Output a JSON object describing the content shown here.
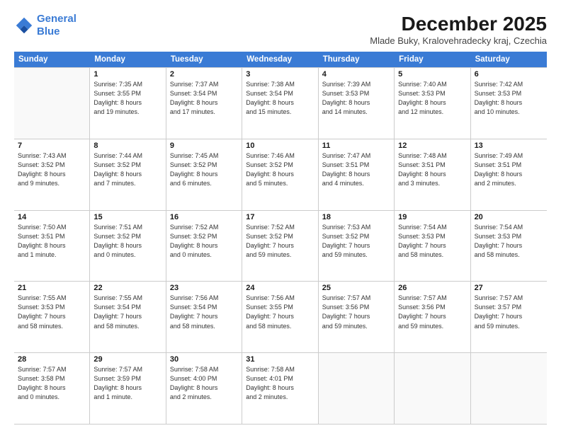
{
  "logo": {
    "line1": "General",
    "line2": "Blue"
  },
  "title": "December 2025",
  "subtitle": "Mlade Buky, Kralovehradecky kraj, Czechia",
  "header_days": [
    "Sunday",
    "Monday",
    "Tuesday",
    "Wednesday",
    "Thursday",
    "Friday",
    "Saturday"
  ],
  "weeks": [
    [
      {
        "day": "",
        "info": ""
      },
      {
        "day": "1",
        "info": "Sunrise: 7:35 AM\nSunset: 3:55 PM\nDaylight: 8 hours\nand 19 minutes."
      },
      {
        "day": "2",
        "info": "Sunrise: 7:37 AM\nSunset: 3:54 PM\nDaylight: 8 hours\nand 17 minutes."
      },
      {
        "day": "3",
        "info": "Sunrise: 7:38 AM\nSunset: 3:54 PM\nDaylight: 8 hours\nand 15 minutes."
      },
      {
        "day": "4",
        "info": "Sunrise: 7:39 AM\nSunset: 3:53 PM\nDaylight: 8 hours\nand 14 minutes."
      },
      {
        "day": "5",
        "info": "Sunrise: 7:40 AM\nSunset: 3:53 PM\nDaylight: 8 hours\nand 12 minutes."
      },
      {
        "day": "6",
        "info": "Sunrise: 7:42 AM\nSunset: 3:53 PM\nDaylight: 8 hours\nand 10 minutes."
      }
    ],
    [
      {
        "day": "7",
        "info": "Sunrise: 7:43 AM\nSunset: 3:52 PM\nDaylight: 8 hours\nand 9 minutes."
      },
      {
        "day": "8",
        "info": "Sunrise: 7:44 AM\nSunset: 3:52 PM\nDaylight: 8 hours\nand 7 minutes."
      },
      {
        "day": "9",
        "info": "Sunrise: 7:45 AM\nSunset: 3:52 PM\nDaylight: 8 hours\nand 6 minutes."
      },
      {
        "day": "10",
        "info": "Sunrise: 7:46 AM\nSunset: 3:52 PM\nDaylight: 8 hours\nand 5 minutes."
      },
      {
        "day": "11",
        "info": "Sunrise: 7:47 AM\nSunset: 3:51 PM\nDaylight: 8 hours\nand 4 minutes."
      },
      {
        "day": "12",
        "info": "Sunrise: 7:48 AM\nSunset: 3:51 PM\nDaylight: 8 hours\nand 3 minutes."
      },
      {
        "day": "13",
        "info": "Sunrise: 7:49 AM\nSunset: 3:51 PM\nDaylight: 8 hours\nand 2 minutes."
      }
    ],
    [
      {
        "day": "14",
        "info": "Sunrise: 7:50 AM\nSunset: 3:51 PM\nDaylight: 8 hours\nand 1 minute."
      },
      {
        "day": "15",
        "info": "Sunrise: 7:51 AM\nSunset: 3:52 PM\nDaylight: 8 hours\nand 0 minutes."
      },
      {
        "day": "16",
        "info": "Sunrise: 7:52 AM\nSunset: 3:52 PM\nDaylight: 8 hours\nand 0 minutes."
      },
      {
        "day": "17",
        "info": "Sunrise: 7:52 AM\nSunset: 3:52 PM\nDaylight: 7 hours\nand 59 minutes."
      },
      {
        "day": "18",
        "info": "Sunrise: 7:53 AM\nSunset: 3:52 PM\nDaylight: 7 hours\nand 59 minutes."
      },
      {
        "day": "19",
        "info": "Sunrise: 7:54 AM\nSunset: 3:53 PM\nDaylight: 7 hours\nand 58 minutes."
      },
      {
        "day": "20",
        "info": "Sunrise: 7:54 AM\nSunset: 3:53 PM\nDaylight: 7 hours\nand 58 minutes."
      }
    ],
    [
      {
        "day": "21",
        "info": "Sunrise: 7:55 AM\nSunset: 3:53 PM\nDaylight: 7 hours\nand 58 minutes."
      },
      {
        "day": "22",
        "info": "Sunrise: 7:55 AM\nSunset: 3:54 PM\nDaylight: 7 hours\nand 58 minutes."
      },
      {
        "day": "23",
        "info": "Sunrise: 7:56 AM\nSunset: 3:54 PM\nDaylight: 7 hours\nand 58 minutes."
      },
      {
        "day": "24",
        "info": "Sunrise: 7:56 AM\nSunset: 3:55 PM\nDaylight: 7 hours\nand 58 minutes."
      },
      {
        "day": "25",
        "info": "Sunrise: 7:57 AM\nSunset: 3:56 PM\nDaylight: 7 hours\nand 59 minutes."
      },
      {
        "day": "26",
        "info": "Sunrise: 7:57 AM\nSunset: 3:56 PM\nDaylight: 7 hours\nand 59 minutes."
      },
      {
        "day": "27",
        "info": "Sunrise: 7:57 AM\nSunset: 3:57 PM\nDaylight: 7 hours\nand 59 minutes."
      }
    ],
    [
      {
        "day": "28",
        "info": "Sunrise: 7:57 AM\nSunset: 3:58 PM\nDaylight: 8 hours\nand 0 minutes."
      },
      {
        "day": "29",
        "info": "Sunrise: 7:57 AM\nSunset: 3:59 PM\nDaylight: 8 hours\nand 1 minute."
      },
      {
        "day": "30",
        "info": "Sunrise: 7:58 AM\nSunset: 4:00 PM\nDaylight: 8 hours\nand 2 minutes."
      },
      {
        "day": "31",
        "info": "Sunrise: 7:58 AM\nSunset: 4:01 PM\nDaylight: 8 hours\nand 2 minutes."
      },
      {
        "day": "",
        "info": ""
      },
      {
        "day": "",
        "info": ""
      },
      {
        "day": "",
        "info": ""
      }
    ]
  ]
}
